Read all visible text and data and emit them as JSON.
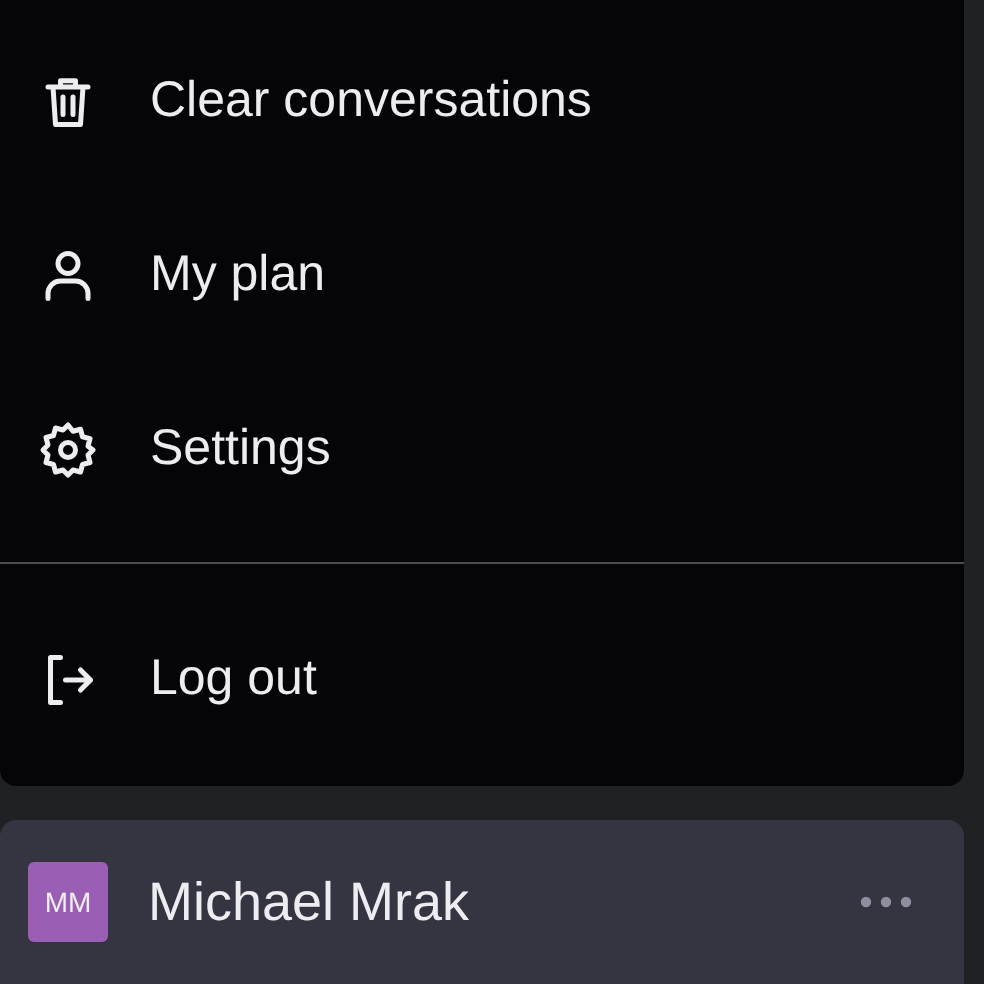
{
  "menu_groups": [
    [
      {
        "label": "Clear conversations"
      },
      {
        "label": "My plan"
      },
      {
        "label": "Settings"
      }
    ],
    [
      {
        "label": "Log out"
      }
    ]
  ],
  "user": {
    "initials": "MM",
    "name": "Michael Mrak",
    "color": "#9b5eb5"
  }
}
